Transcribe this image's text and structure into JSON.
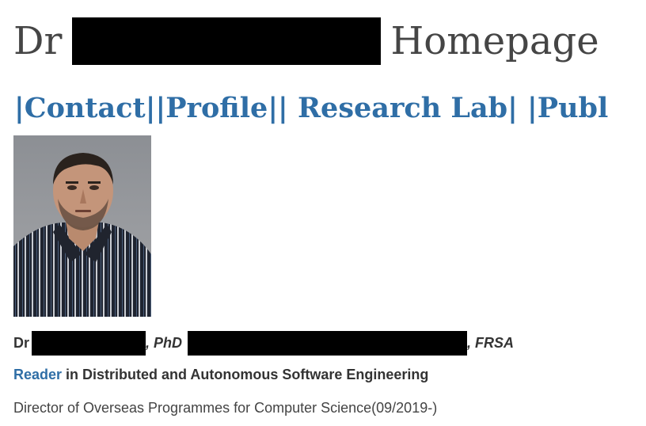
{
  "header": {
    "title_prefix": "Dr",
    "title_suffix": "Homepage"
  },
  "nav": {
    "items": [
      {
        "label": "Contact"
      },
      {
        "label": "Profile"
      },
      {
        "label": " Research Lab"
      },
      {
        "label": "Publ"
      }
    ],
    "separator": "|"
  },
  "photo": {
    "alt": "profile photo"
  },
  "bio": {
    "name_prefix": "Dr",
    "credentials": ", PhD",
    "fellowship": ", FRSA",
    "role_link": "Reader",
    "role_rest": " in Distributed and Autonomous Software Engineering",
    "position": "Director of Overseas Programmes for Computer Science(09/2019-)"
  },
  "colors": {
    "link": "#2f6ea6",
    "title": "#454545",
    "text": "#333333"
  }
}
